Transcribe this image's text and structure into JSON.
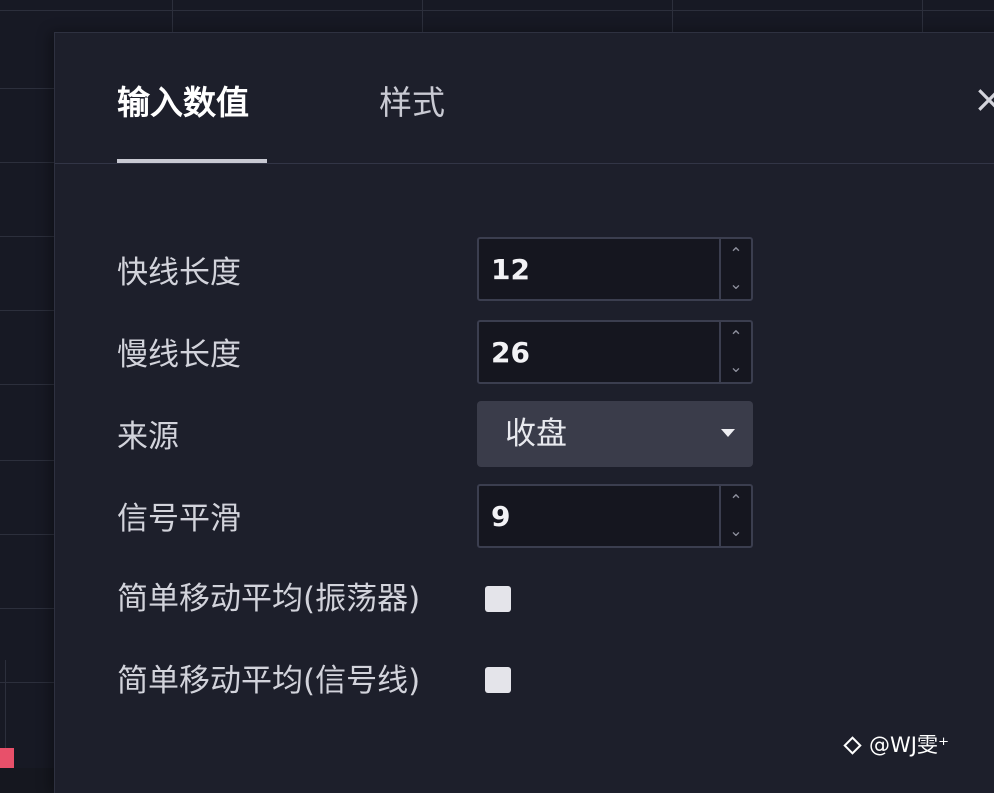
{
  "tabs": [
    {
      "label": "输入数值",
      "active": true
    },
    {
      "label": "样式",
      "active": false
    }
  ],
  "close_label": "×",
  "inputs": {
    "fast_length": {
      "label": "快线长度",
      "value": "12"
    },
    "slow_length": {
      "label": "慢线长度",
      "value": "26"
    },
    "source": {
      "label": "来源",
      "value": "收盘"
    },
    "signal_smoothing": {
      "label": "信号平滑",
      "value": "9"
    },
    "sma_oscillator": {
      "label": "简单移动平均(振荡器)",
      "checked": false
    },
    "sma_signal": {
      "label": "简单移动平均(信号线)",
      "checked": false
    }
  },
  "spinner": {
    "up": "⌃",
    "down": "⌄"
  },
  "watermark": "@WJ雯⁺",
  "colors": {
    "background": "#171924",
    "dialog": "#1d1f2b",
    "input_bg": "#15161f",
    "select_bg": "#3a3c4a",
    "candle_red": "#e8506a"
  }
}
